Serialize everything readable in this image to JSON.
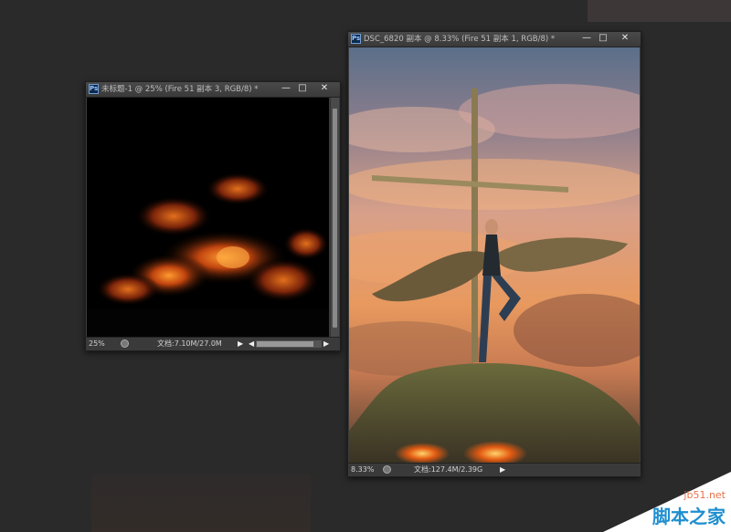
{
  "window_left": {
    "title": "未标题-1 @ 25% (Fire 51 副本 3, RGB/8) *",
    "zoom": "25%",
    "doc_info": "文档:7.10M/27.0M"
  },
  "window_right": {
    "title": "DSC_6820 副本 @ 8.33% (Fire 51 副本 1, RGB/8) *",
    "zoom": "8.33%",
    "doc_info": "文档:127.4M/2.39G"
  },
  "window_buttons": {
    "minimize": "—",
    "maximize": "□",
    "close": "✕"
  },
  "ps_badge": "Ps",
  "nav": {
    "play": "▶",
    "left": "◀",
    "right": "▶"
  },
  "watermark": {
    "url": "jb51.net",
    "site_name": "脚本之家"
  }
}
